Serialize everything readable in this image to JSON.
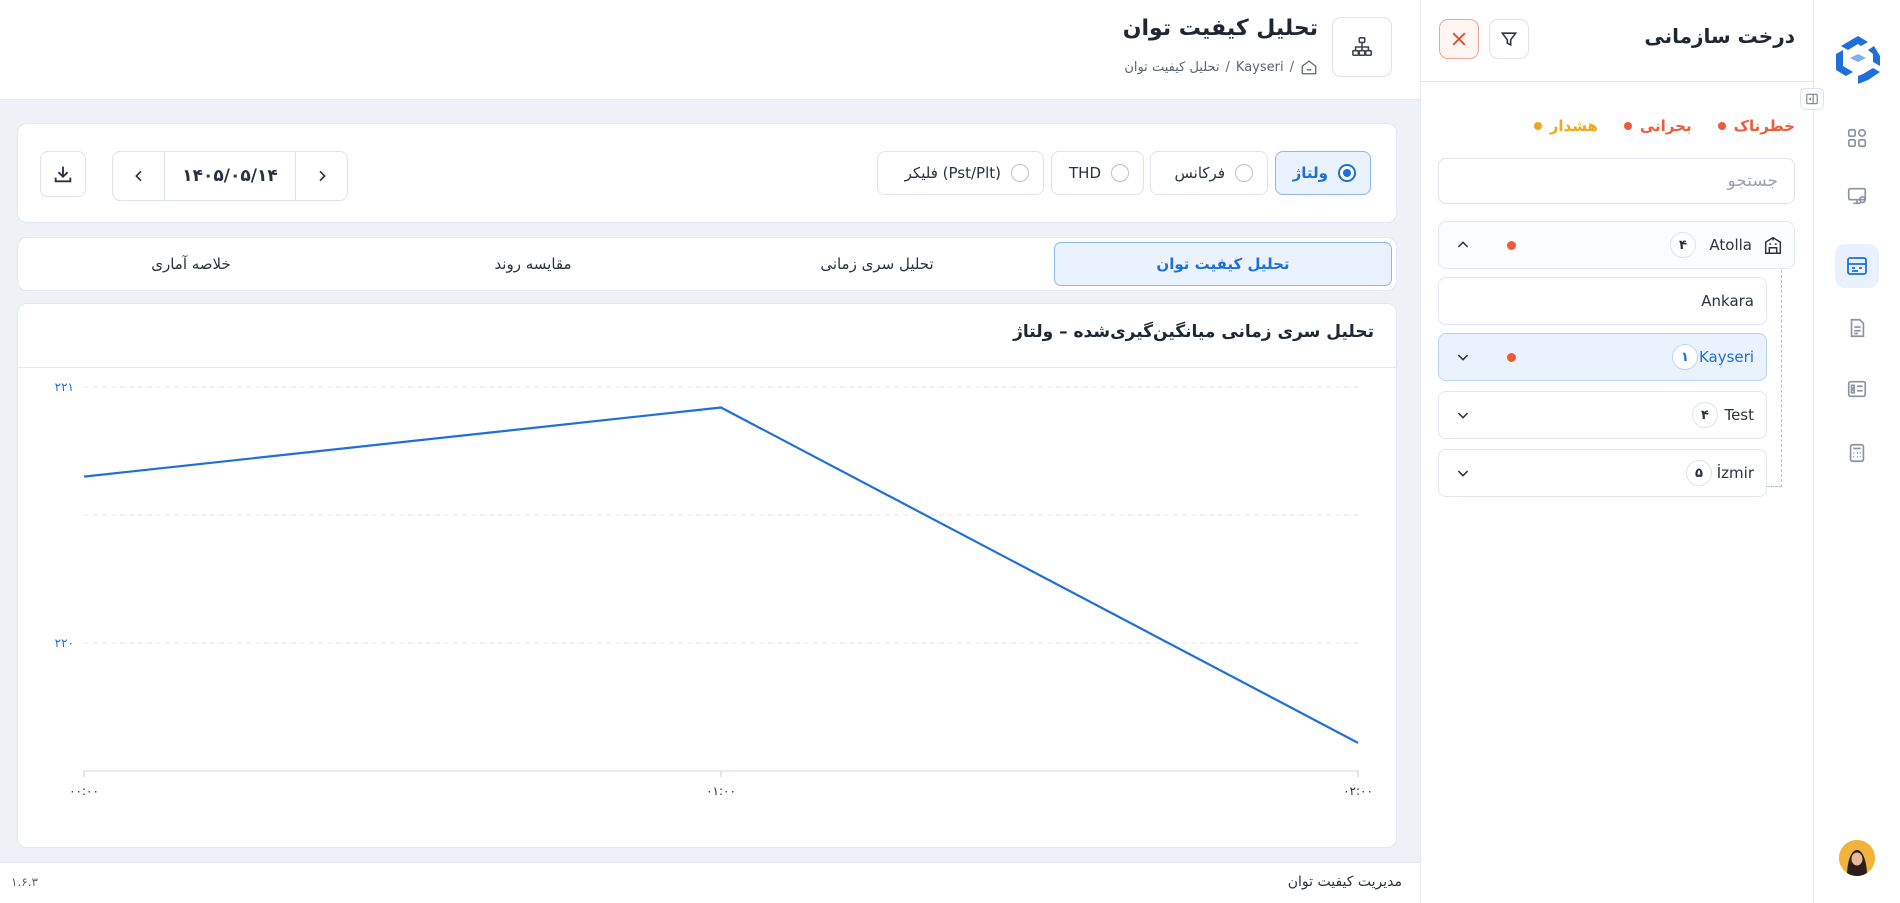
{
  "tree": {
    "title": "درخت سازمانی",
    "legend": [
      {
        "label": "هشدار",
        "color": "#f0a818"
      },
      {
        "label": "بحرانی",
        "color": "#ee5a3a"
      },
      {
        "label": "خطرناک",
        "color": "#ee5a3a"
      }
    ],
    "search_placeholder": "جستجو",
    "nodes": [
      {
        "label": "Atolla",
        "count": "۴",
        "expanded": true,
        "alert": true
      },
      {
        "label": "Ankara",
        "count": "",
        "expanded": false,
        "alert": false
      },
      {
        "label": "Kayseri",
        "count": "۱",
        "expanded": false,
        "alert": true,
        "selected": true
      },
      {
        "label": "Test",
        "count": "۴",
        "expanded": false,
        "alert": false
      },
      {
        "label": "İzmir",
        "count": "۵",
        "expanded": false,
        "alert": false
      }
    ]
  },
  "header": {
    "title": "تحلیل کیفیت توان",
    "breadcrumb": [
      "Kayseri",
      "تحلیل کیفیت توان"
    ]
  },
  "controls": {
    "parameters": [
      {
        "label": "ولتاژ",
        "selected": true
      },
      {
        "label": "فرکانس",
        "selected": false
      },
      {
        "label": "THD",
        "selected": false
      },
      {
        "label": "فلیکر (Pst/Plt)",
        "selected": false
      }
    ],
    "date": "۱۴۰۵/۰۵/۱۴"
  },
  "tabs": [
    {
      "label": "تحلیل کیفیت توان",
      "active": true
    },
    {
      "label": "تحلیل سری زمانی",
      "active": false
    },
    {
      "label": "مقایسه روند",
      "active": false
    },
    {
      "label": "خلاصه آماری",
      "active": false
    }
  ],
  "chart_title": "تحلیل سری زمانی میانگین‌گیری‌شده – ولتاژ",
  "chart_data": {
    "type": "line",
    "x": [
      "۰۰:۰۰",
      "۰۱:۰۰",
      "۰۲:۰۰"
    ],
    "series": [
      {
        "values": [
          220.65,
          220.92,
          219.61
        ]
      }
    ],
    "yticks": [
      {
        "value": 220,
        "label": "۲۲۰"
      },
      {
        "value": 221,
        "label": "۲۲۱"
      }
    ],
    "ylim": [
      219.5,
      221.0
    ],
    "color": "#1e6fd9",
    "grid": true
  },
  "footer": {
    "app_name": "مدیریت کیفیت توان",
    "version": "۱.۶.۳"
  }
}
